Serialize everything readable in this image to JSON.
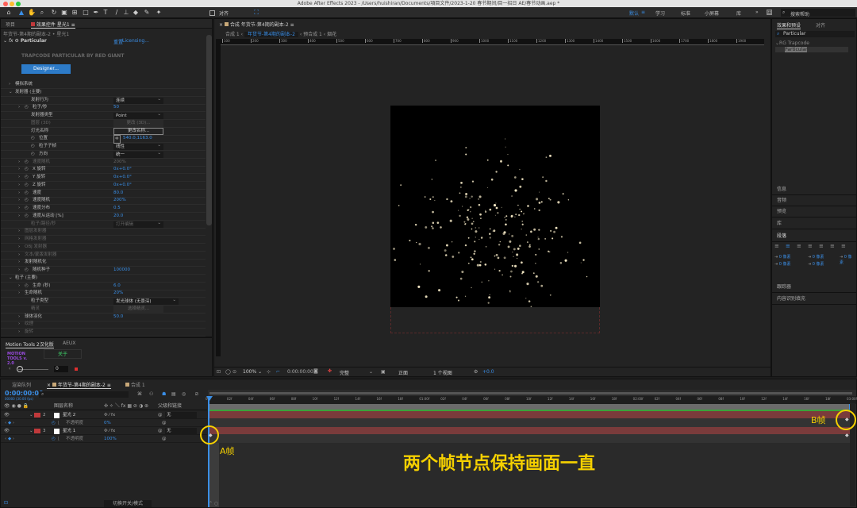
{
  "window": {
    "title": "Adobe After Effects 2023 - /Users/huishiran/Documents/項目文件/2023-1-20 春节期间/目一招日 AE/春节动画.aep *"
  },
  "toolbar": {
    "align_label": "对齐",
    "workspaces": [
      "默认",
      "学习",
      "标准",
      "小屏幕",
      "库"
    ],
    "active_workspace": "默认",
    "search_placeholder": "搜索帮助"
  },
  "left_panel": {
    "tabs": [
      "项目",
      "效果控件 星光1"
    ],
    "active_tab": "效果控件 星光1",
    "breadcrumb": "年货节-第4期的副本-2 • 星光1",
    "effect_name": "Particular",
    "reset_label": "重置",
    "licensing_label": "Licensing...",
    "plugin_title": "TRAPCODE PARTICULAR BY RED GIANT",
    "designer_button": "Designer...",
    "properties": [
      {
        "indent": 1,
        "arrow": ">",
        "label": "模拟系统"
      },
      {
        "indent": 1,
        "arrow": "v",
        "label": "发射器 (主要)"
      },
      {
        "indent": 3,
        "label": "发射行为",
        "dropdown": "连续"
      },
      {
        "indent": 2,
        "arrow": ">",
        "stopwatch": true,
        "label": "粒子/秒",
        "value": "50"
      },
      {
        "indent": 3,
        "label": "发射器类型",
        "dropdown": "Point"
      },
      {
        "indent": 3,
        "label": "图层 (3D)",
        "value": "更改 (3D)...",
        "disabled": true
      },
      {
        "indent": 3,
        "label": "灯光名称",
        "button": "更改名称..."
      },
      {
        "indent": 3,
        "stopwatch": true,
        "label": "位置",
        "value": "540.0,1163.0",
        "crosshair": true
      },
      {
        "indent": 3,
        "stopwatch": true,
        "label": "粒子子帧",
        "dropdown": "线性"
      },
      {
        "indent": 3,
        "stopwatch": true,
        "label": "方向",
        "dropdown": "统一"
      },
      {
        "indent": 2,
        "arrow": ">",
        "stopwatch": true,
        "label": "速度随机",
        "value": "200%",
        "disabled": true
      },
      {
        "indent": 2,
        "arrow": ">",
        "stopwatch": true,
        "label": "X 旋转",
        "value": "0x+0.0°"
      },
      {
        "indent": 2,
        "arrow": ">",
        "stopwatch": true,
        "label": "Y 旋转",
        "value": "0x+0.0°"
      },
      {
        "indent": 2,
        "arrow": ">",
        "stopwatch": true,
        "label": "Z 旋转",
        "value": "0x+0.0°"
      },
      {
        "indent": 2,
        "arrow": ">",
        "stopwatch": true,
        "label": "速度",
        "value": "80.0"
      },
      {
        "indent": 2,
        "arrow": ">",
        "stopwatch": true,
        "label": "速度随机",
        "value": "200%"
      },
      {
        "indent": 2,
        "arrow": ">",
        "stopwatch": true,
        "label": "速度分布",
        "value": "0.5"
      },
      {
        "indent": 2,
        "arrow": ">",
        "stopwatch": true,
        "label": "速度从运动 [%]",
        "value": "20.0"
      },
      {
        "indent": 3,
        "label": "粒子/路径/秒",
        "dropdown": "打开编辑",
        "disabled": true
      },
      {
        "indent": 2,
        "arrow": ">",
        "label": "图层发射器",
        "disabled": true
      },
      {
        "indent": 2,
        "arrow": ">",
        "label": "网格发射器",
        "disabled": true
      },
      {
        "indent": 2,
        "arrow": ">",
        "label": "OBJ 发射器",
        "disabled": true
      },
      {
        "indent": 2,
        "arrow": ">",
        "label": "文本/蒙版发射器",
        "disabled": true
      },
      {
        "indent": 2,
        "arrow": ">",
        "label": "发射随机化"
      },
      {
        "indent": 2,
        "arrow": ">",
        "stopwatch": true,
        "label": "随机种子",
        "value": "100000"
      },
      {
        "indent": 1,
        "arrow": "v",
        "label": "粒子 (主要)"
      },
      {
        "indent": 2,
        "arrow": ">",
        "stopwatch": true,
        "label": "生命 (秒)",
        "value": "6.0"
      },
      {
        "indent": 2,
        "arrow": ">",
        "label": "生命随机",
        "value": "20%"
      },
      {
        "indent": 3,
        "label": "粒子类型",
        "dropdown": "发光球体 (无景深)",
        "wide": true
      },
      {
        "indent": 3,
        "label": "精灵",
        "value": "选择精灵...",
        "disabled": true
      },
      {
        "indent": 2,
        "arrow": ">",
        "label": "球体羽化",
        "value": "50.0"
      },
      {
        "indent": 2,
        "arrow": ">",
        "label": "纹理",
        "disabled": true
      },
      {
        "indent": 2,
        "arrow": ">",
        "label": "旋转",
        "disabled": true
      }
    ]
  },
  "motion_tools": {
    "tabs": [
      "Motion Tools 2汉化版",
      "AEUX"
    ],
    "logo": "MOTION TOOLS v. 2.0",
    "about_button": "关于",
    "value": "0"
  },
  "composition": {
    "tab_label": "合成 年货节-第4期的副本-2",
    "breadcrumb": [
      "合成 1",
      "年货节-第4期的副本-2",
      "预合成 1",
      "烟花"
    ],
    "ruler_labels": [
      "100",
      "200",
      "300",
      "400",
      "500",
      "600",
      "700",
      "800",
      "900",
      "1000",
      "1100",
      "1200",
      "1300",
      "1400",
      "1500",
      "1600",
      "1700",
      "1800",
      "1900"
    ],
    "zoom": "100%",
    "timecode": "0:00:00:00",
    "resolution": "完整",
    "view": "正面",
    "views": "1 个视图",
    "exposure": "+0.0"
  },
  "right_panel": {
    "tabs": [
      "效果和预设",
      "对齐"
    ],
    "search_value": "Particular",
    "category": "RG Trapcode",
    "result": "Particular",
    "sections": [
      "信息",
      "音频",
      "预览",
      "库",
      "段落",
      "跟踪器",
      "内容识别填充"
    ],
    "paragraph_fields": [
      "0 像素",
      "0 像素",
      "0 像素",
      "0 像素",
      "0 像素"
    ]
  },
  "timeline": {
    "tabs": [
      "渲染队列",
      "年货节-第4期的副本-2",
      "合成 1"
    ],
    "timecode": "0:00:00:00",
    "timecode_sub": "00000 (30.00 fps)",
    "columns": {
      "name": "图层名称",
      "parent": "父级和链接"
    },
    "layers": [
      {
        "num": "2",
        "name": "星光 2",
        "parent": "无",
        "color": "#c0393b"
      },
      {
        "sub": true,
        "name": "不透明度",
        "value": "0%"
      },
      {
        "num": "3",
        "name": "星光 1",
        "parent": "无",
        "color": "#c0393b"
      },
      {
        "sub": true,
        "name": "不透明度",
        "value": "100%"
      }
    ],
    "ruler_labels": [
      "00f",
      "02f",
      "04f",
      "06f",
      "08f",
      "10f",
      "12f",
      "14f",
      "16f",
      "18f",
      "01:00f",
      "02f",
      "04f",
      "06f",
      "08f",
      "10f",
      "12f",
      "14f",
      "16f",
      "18f",
      "02:00f",
      "02f",
      "04f",
      "06f",
      "08f",
      "10f",
      "12f",
      "14f",
      "16f",
      "18f",
      "03:00f"
    ],
    "toggle_label": "切换开关/模式"
  },
  "annotations": {
    "a_label": "A帧",
    "b_label": "B帧",
    "caption": "两个帧节点保持画面一直",
    "color": "#f5d000"
  },
  "colors": {
    "accent": "#2d8ceb",
    "label_red": "#c0393b",
    "track_bar": "#7a3b3b",
    "work_area": "#3aa33a"
  }
}
